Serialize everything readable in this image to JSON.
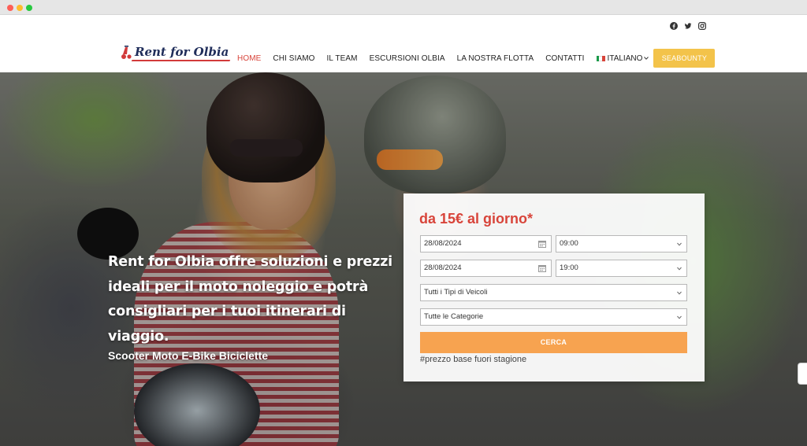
{
  "header": {
    "logo_text": "Rent for Olbia",
    "social_icons": [
      "facebook-icon",
      "twitter-icon",
      "instagram-icon"
    ],
    "nav": [
      {
        "label": "HOME",
        "active": true
      },
      {
        "label": "CHI SIAMO"
      },
      {
        "label": "IL TEAM"
      },
      {
        "label": "ESCURSIONI OLBIA"
      },
      {
        "label": "LA NOSTRA FLOTTA"
      },
      {
        "label": "CONTATTI"
      }
    ],
    "language": "ITALIANO",
    "cta": "SEABOUNTY"
  },
  "hero": {
    "title": "Rent for Olbia offre soluzioni e prezzi ideali per il moto noleggio e potrà consigliari per i tuoi itinerari di viaggio.",
    "subtitle": "Scooter Moto E-Bike Biciclette"
  },
  "booking": {
    "price_title": "da 15€ al giorno*",
    "pickup_date": "28/08/2024",
    "pickup_time": "09:00",
    "return_date": "28/08/2024",
    "return_time": "19:00",
    "vehicle_type": "Tutti i Tipi di Veicoli",
    "category": "Tutte le Categorie",
    "search_label": "CERCA",
    "note": "#prezzo base fuori stagione"
  },
  "colors": {
    "accent_red": "#d8443a",
    "cta_yellow": "#f3c34a",
    "search_orange": "#f7a350"
  }
}
